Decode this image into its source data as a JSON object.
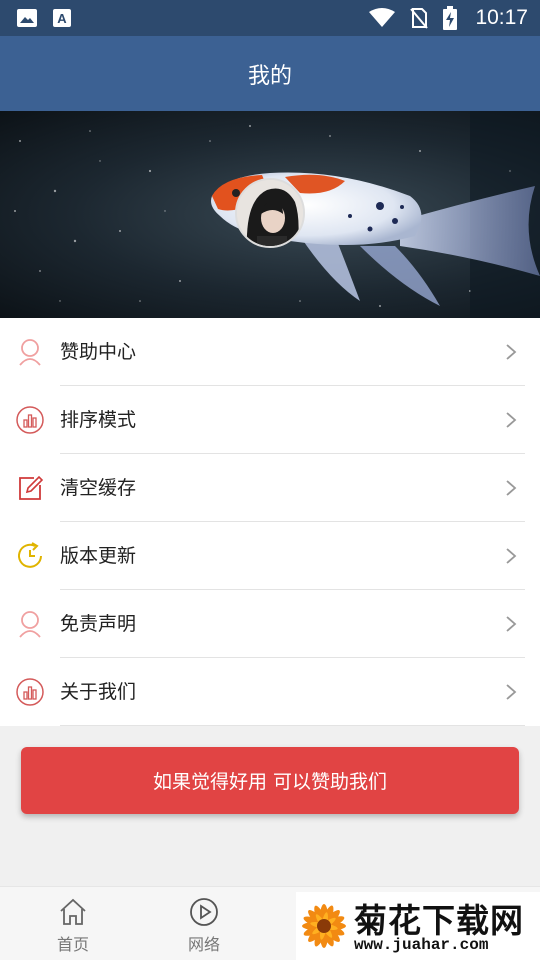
{
  "status_bar": {
    "time": "10:17",
    "icons": [
      "image-icon",
      "font-icon",
      "wifi-icon",
      "no-sim-icon",
      "battery-charging-icon"
    ]
  },
  "app_bar": {
    "title": "我的"
  },
  "menu": {
    "items": [
      {
        "label": "赞助中心",
        "icon": "user-icon"
      },
      {
        "label": "排序模式",
        "icon": "chart-icon"
      },
      {
        "label": "清空缓存",
        "icon": "edit-icon"
      },
      {
        "label": "版本更新",
        "icon": "update-clock-icon"
      },
      {
        "label": "免责声明",
        "icon": "user-icon"
      },
      {
        "label": "关于我们",
        "icon": "chart-icon"
      }
    ]
  },
  "sponsor_button": {
    "label": "如果觉得好用 可以赞助我们"
  },
  "bottom_nav": {
    "items": [
      {
        "label": "首页",
        "icon": "home-icon"
      },
      {
        "label": "网络",
        "icon": "play-icon"
      }
    ]
  },
  "watermark": {
    "title": "菊花下载网",
    "url": "www.juahar.com"
  },
  "colors": {
    "status_bar": "#2d4a6e",
    "app_bar": "#3c6193",
    "accent_red": "#e14444",
    "icon_yellow": "#e0b400"
  }
}
